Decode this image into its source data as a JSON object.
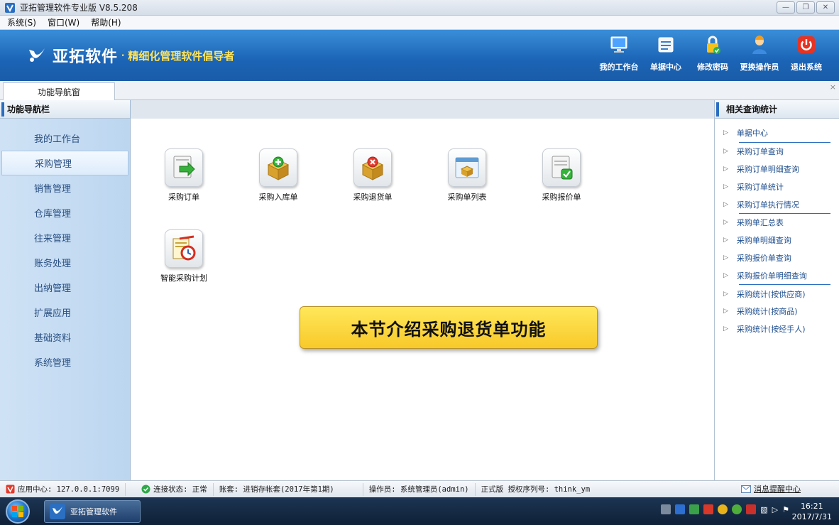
{
  "window": {
    "title": "亚拓管理软件专业版 V8.5.208"
  },
  "menu": {
    "items": [
      "系统(S)",
      "窗口(W)",
      "帮助(H)"
    ]
  },
  "banner": {
    "brand_name": "亚拓软件",
    "brand_dot": "·",
    "slogan": "精细化管理软件倡导者",
    "tools": [
      "我的工作台",
      "单据中心",
      "修改密码",
      "更换操作员",
      "退出系统"
    ]
  },
  "tabs": {
    "active": "功能导航窗",
    "close": "×"
  },
  "leftnav": {
    "header": "功能导航栏",
    "items": [
      "我的工作台",
      "采购管理",
      "销售管理",
      "仓库管理",
      "往来管理",
      "账务处理",
      "出纳管理",
      "扩展应用",
      "基础资料",
      "系统管理"
    ],
    "active_index": 1
  },
  "main": {
    "features": [
      "采购订单",
      "采购入库单",
      "采购退货单",
      "采购单列表",
      "采购报价单",
      "智能采购计划"
    ],
    "callout": "本节介绍采购退货单功能"
  },
  "rightpanel": {
    "header": "相关查询统计",
    "links": [
      "单据中心",
      "采购订单查询",
      "采购订单明细查询",
      "采购订单统计",
      "采购订单执行情况",
      "采购单汇总表",
      "采购单明细查询",
      "采购报价单查询",
      "采购报价单明细查询",
      "采购统计(按供应商)",
      "采购统计(按商品)",
      "采购统计(按经手人)"
    ]
  },
  "statusbar": {
    "app_center": "应用中心: 127.0.0.1:7099",
    "connection": "连接状态: 正常",
    "account": "账套: 进销存帐套(2017年第1期)",
    "operator": "操作员: 系统管理员(admin)",
    "license": "正式版 授权序列号: think_ym",
    "message_center": "消息提醒中心"
  },
  "taskbar": {
    "app_label": "亚拓管理软件",
    "time": "16:21",
    "date": "2017/7/31"
  },
  "colors": {
    "banner": "#1b64b6",
    "slogan": "#ffe35a",
    "callout": "#fbd63a",
    "link": "#1f4f8e"
  }
}
